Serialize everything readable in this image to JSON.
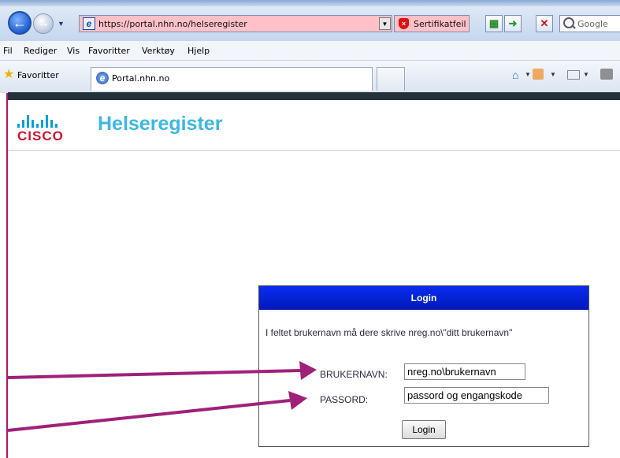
{
  "browser": {
    "url": "https://portal.nhn.no/helseregister",
    "cert_error": "Sertifikatfeil",
    "search_placeholder": "Google",
    "menu": [
      "Fil",
      "Rediger",
      "Vis",
      "Favoritter",
      "Verktøy",
      "Hjelp"
    ],
    "favorites_label": "Favoritter",
    "tab_title": "Portal.nhn.no"
  },
  "page": {
    "logo_text": "CISCO",
    "site_title": "Helseregister"
  },
  "login": {
    "header": "Login",
    "info": "I feltet brukernavn må dere skrive nreg.no\\\"ditt brukernavn\"",
    "username_label": "BRUKERNAVN:",
    "username_value": "nreg.no\\brukernavn",
    "password_label": "PASSORD:",
    "password_value": "passord og engangskode",
    "button_label": "Login"
  },
  "colors": {
    "login_header": "#0a2cf0",
    "arrow": "#a0207a",
    "cisco_red": "#d0112b",
    "cisco_blue": "#049fd9",
    "title_blue": "#3bb8e4",
    "cert_error_bg": "#ffc0c8"
  }
}
